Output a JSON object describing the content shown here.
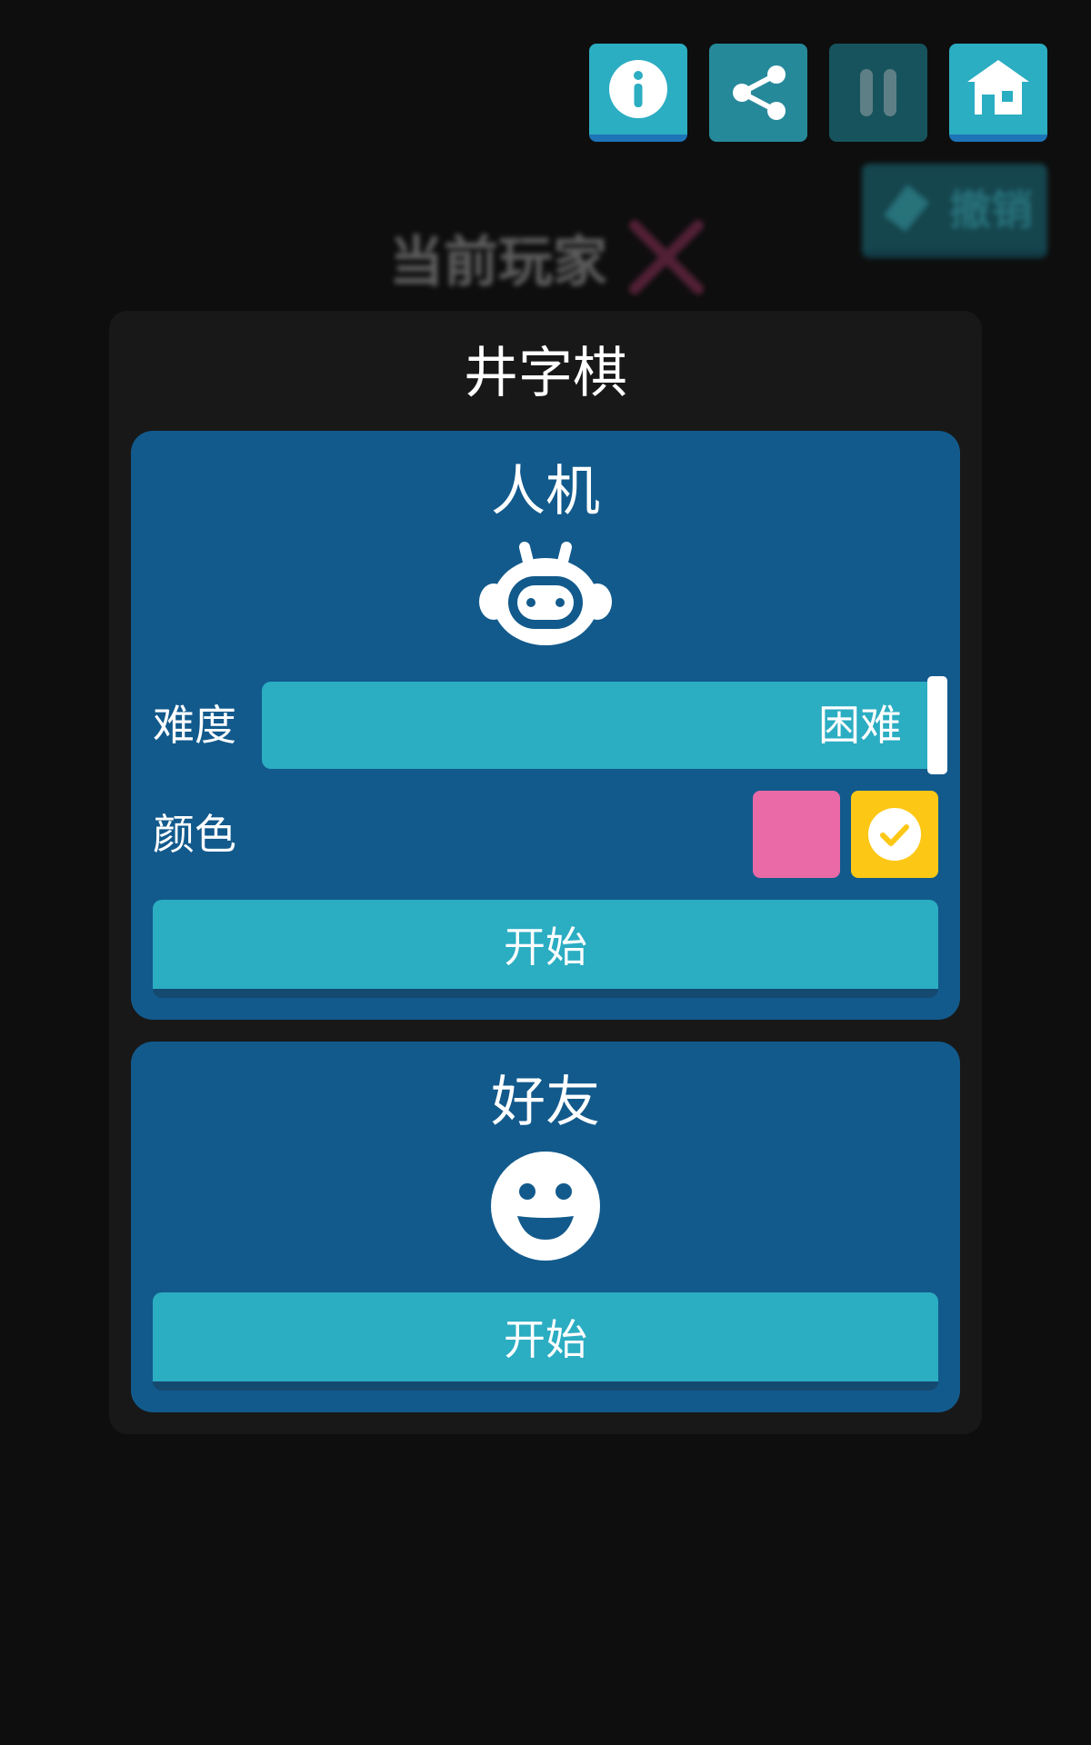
{
  "toolbar": {
    "info_icon": "info-icon",
    "share_icon": "share-icon",
    "pause_icon": "pause-icon",
    "home_icon": "home-icon",
    "undo_label": "撤销"
  },
  "status": {
    "current_player_label": "当前玩家",
    "current_player_symbol": "X"
  },
  "dialog": {
    "title": "井字棋",
    "modes": [
      {
        "title": "人机",
        "icon": "robot-icon",
        "difficulty_label": "难度",
        "difficulty_value": "困难",
        "color_label": "颜色",
        "colors": [
          "#e96aa7",
          "#fdc716"
        ],
        "selected_color": "#fdc716",
        "start_label": "开始"
      },
      {
        "title": "好友",
        "icon": "smiley-icon",
        "start_label": "开始"
      }
    ]
  },
  "colors": {
    "background": "#0e0e0e",
    "panel": "#181818",
    "card": "#125a8c",
    "accent": "#2badc2",
    "player_x": "#8a2f56"
  }
}
